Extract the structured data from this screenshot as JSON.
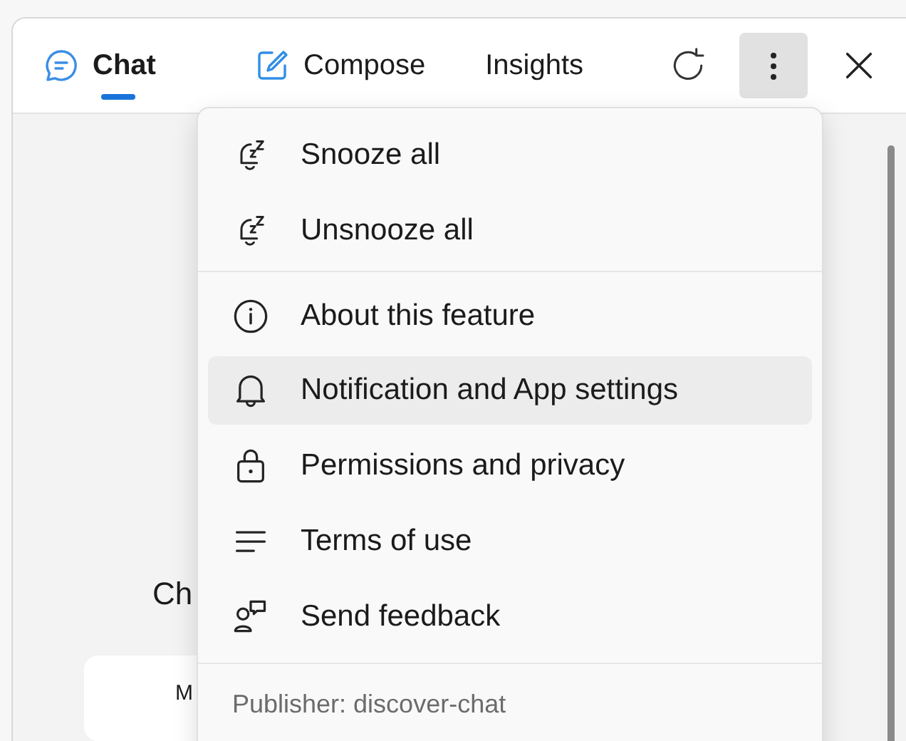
{
  "tabs": [
    {
      "label": "Chat",
      "selected": true
    },
    {
      "label": "Compose",
      "selected": false
    },
    {
      "label": "Insights",
      "selected": false
    }
  ],
  "toolbar": {
    "more_active": true
  },
  "background": {
    "heading": "Ch",
    "card_text": "M"
  },
  "menu": {
    "groups": [
      [
        {
          "label": "Snooze all",
          "highlighted": false
        },
        {
          "label": "Unsnooze all",
          "highlighted": false
        }
      ],
      [
        {
          "label": "About this feature",
          "highlighted": false
        },
        {
          "label": "Notification and App settings",
          "highlighted": true
        },
        {
          "label": "Permissions and privacy",
          "highlighted": false
        },
        {
          "label": "Terms of use",
          "highlighted": false
        },
        {
          "label": "Send feedback",
          "highlighted": false
        }
      ]
    ],
    "footer": "Publisher: discover-chat"
  }
}
